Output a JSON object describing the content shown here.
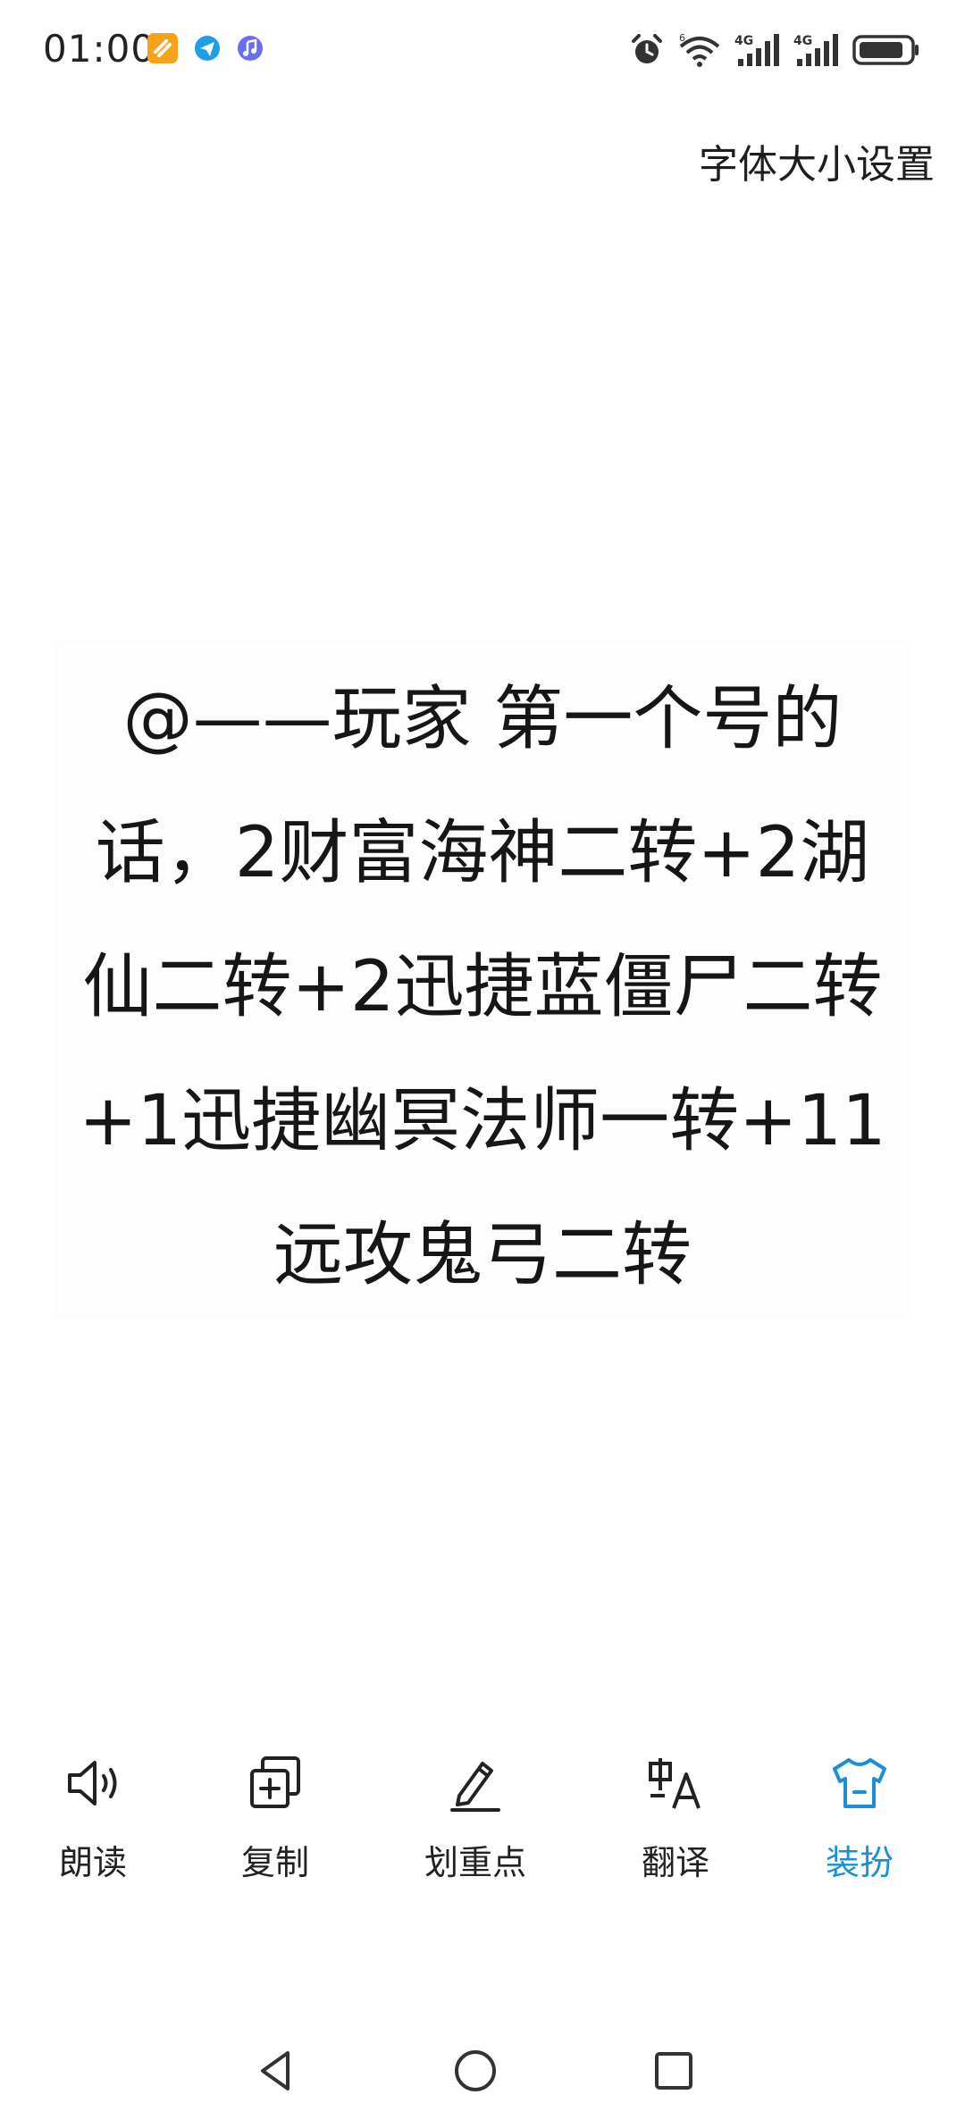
{
  "status_bar": {
    "time": "01:00",
    "notification_icons": [
      "app-notification-icon",
      "telegram-icon",
      "music-icon"
    ],
    "right_icons": [
      "alarm-icon",
      "wifi-icon",
      "signal-4g-icon",
      "signal-4g-icon",
      "battery-icon"
    ],
    "wifi_label": "6",
    "signal_label_1": "4G",
    "signal_label_2": "4G"
  },
  "header": {
    "font_size_setting": "字体大小设置"
  },
  "content": {
    "text": "@——玩家 第一个号的话，2财富海神二转+2湖仙二转+2迅捷蓝僵尸二转+1迅捷幽冥法师一转+11远攻鬼弓二转"
  },
  "toolbar": {
    "items": [
      {
        "label": "朗读",
        "icon": "speaker-icon"
      },
      {
        "label": "复制",
        "icon": "copy-icon"
      },
      {
        "label": "划重点",
        "icon": "pen-icon"
      },
      {
        "label": "翻译",
        "icon": "translate-icon"
      },
      {
        "label": "装扮",
        "icon": "tshirt-icon"
      }
    ],
    "active_color": "#1a8fd8"
  },
  "nav_bar": {
    "buttons": [
      "back-icon",
      "home-icon",
      "recents-icon"
    ]
  }
}
